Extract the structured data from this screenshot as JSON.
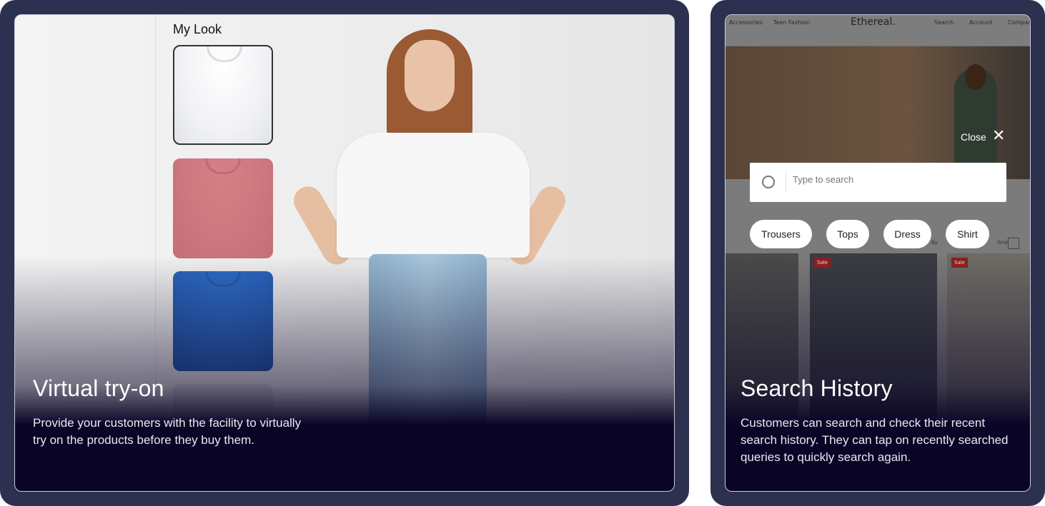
{
  "left_card": {
    "panel_title": "My Look",
    "title": "Virtual try-on",
    "description": "Provide your customers with the facility to virtually try on the products before they buy them.",
    "swatches": [
      {
        "color": "#f2f3f6",
        "selected": true
      },
      {
        "color": "#cf7880",
        "selected": false
      },
      {
        "color": "#2a64bc",
        "selected": false
      }
    ]
  },
  "right_card": {
    "store": {
      "logo": "Ethereal.",
      "nav_left": [
        "Accessories",
        "Teen Fashion"
      ],
      "nav_right": [
        "Search",
        "Account",
        "Compare"
      ],
      "grid_label": "Grid",
      "sort_label": "By",
      "sale_badge": "Sale"
    },
    "close_label": "Close",
    "search_placeholder": "Type to search",
    "chips": [
      "Trousers",
      "Tops",
      "Dress",
      "Shirt"
    ],
    "title": "Search History",
    "description": "Customers can search and check their recent search history. They can tap on recently searched queries to quickly search again."
  },
  "colors": {
    "frame": "#2d3150",
    "overlay": "#0a0526"
  }
}
